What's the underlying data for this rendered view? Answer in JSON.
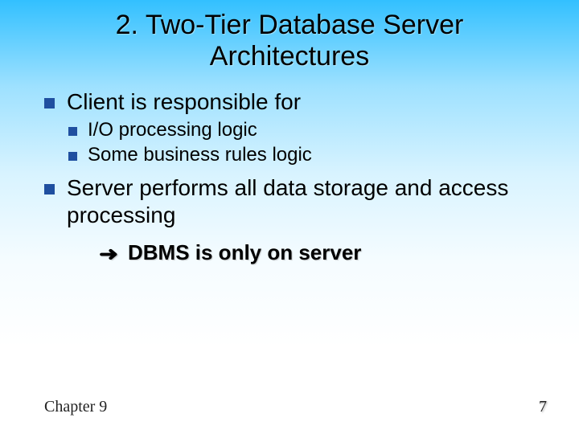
{
  "title_line1": "2. Two-Tier Database Server",
  "title_line2": "Architectures",
  "bullets": {
    "b1": "Client is responsible for",
    "b1a": "I/O processing logic",
    "b1b": "Some business rules logic",
    "b2": "Server performs all data storage and access processing",
    "arrow": "DBMS is only on server"
  },
  "footer": {
    "left": "Chapter 9",
    "right": "7"
  }
}
